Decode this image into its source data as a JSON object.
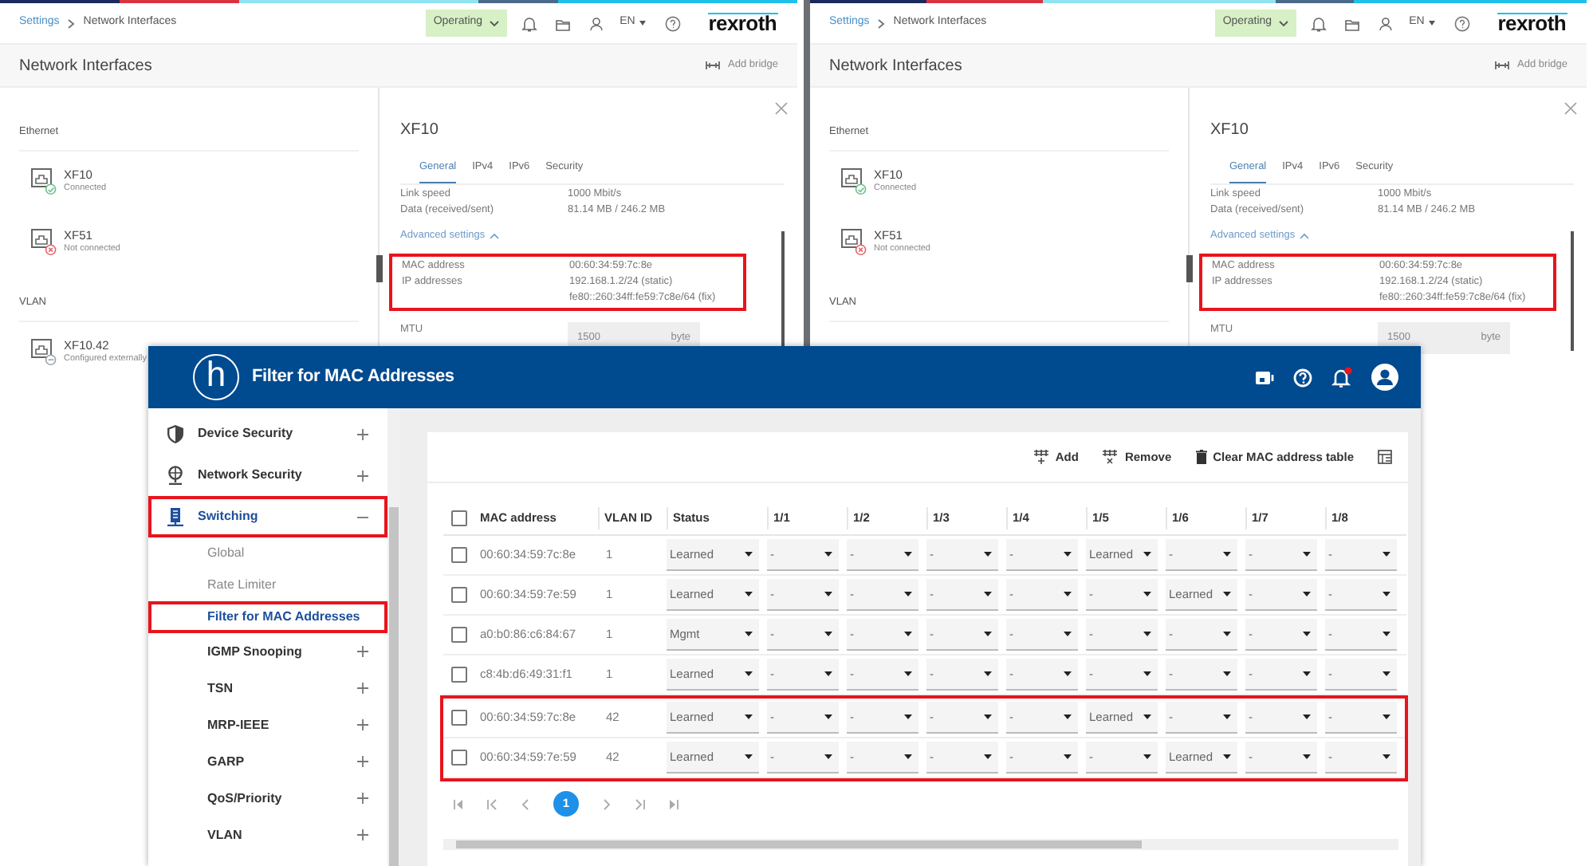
{
  "screens": [
    {
      "breadcrumb": [
        "Settings",
        "Network Interfaces"
      ],
      "mode": "Operating",
      "language": "EN",
      "brand": "rexroth",
      "page_title": "Network Interfaces",
      "add_bridge": "Add bridge",
      "groups": [
        {
          "heading": "Ethernet",
          "items": [
            {
              "name": "XF10",
              "status": "Connected",
              "kind": "connected"
            },
            {
              "name": "XF51",
              "status": "Not connected",
              "kind": "disconnected"
            }
          ]
        },
        {
          "heading": "VLAN",
          "items": [
            {
              "name": "XF10.42",
              "status": "Configured externally",
              "kind": "external"
            }
          ]
        }
      ],
      "detail": {
        "title": "XF10",
        "tabs": [
          {
            "label": "General",
            "selected": true
          },
          {
            "label": "IPv4",
            "selected": false
          },
          {
            "label": "IPv6",
            "selected": false
          },
          {
            "label": "Security",
            "selected": false
          }
        ],
        "fields": [
          {
            "label": "Link speed",
            "values": [
              "1000 Mbit/s"
            ]
          },
          {
            "label": "Data (received/sent)",
            "values": [
              "81.14 MB / 246.2 MB"
            ]
          }
        ],
        "advanced_link": "Advanced settings",
        "advanced_highlighted": true,
        "advanced_fields": [
          {
            "label": "MAC address",
            "values": [
              "00:60:34:59:7c:8e"
            ]
          },
          {
            "label": "IP addresses",
            "values": [
              "192.168.1.2/24 (static)",
              "fe80::260:34ff:fe59:7c8e/64 (fix)"
            ]
          }
        ],
        "mtu": {
          "label": "MTU",
          "value": "1500",
          "unit": "byte"
        }
      }
    },
    {
      "breadcrumb": [
        "Settings",
        "Network Interfaces"
      ],
      "mode": "Operating",
      "language": "EN",
      "brand": "rexroth",
      "page_title": "Network Interfaces",
      "add_bridge": "Add bridge",
      "groups": [
        {
          "heading": "Ethernet",
          "items": [
            {
              "name": "XF10",
              "status": "Connected",
              "kind": "connected"
            },
            {
              "name": "XF51",
              "status": "Not connected",
              "kind": "disconnected"
            }
          ]
        },
        {
          "heading": "VLAN"
        }
      ],
      "detail": {
        "title": "XF10",
        "tabs": [
          {
            "label": "General",
            "selected": true
          },
          {
            "label": "IPv4",
            "selected": false
          },
          {
            "label": "IPv6",
            "selected": false
          },
          {
            "label": "Security",
            "selected": false
          }
        ],
        "fields": [
          {
            "label": "Link speed",
            "values": [
              "1000 Mbit/s"
            ]
          },
          {
            "label": "Data (received/sent)",
            "values": [
              "81.14 MB / 246.2 MB"
            ]
          }
        ],
        "advanced_link": "Advanced settings",
        "advanced_highlighted": true,
        "advanced_fields": [
          {
            "label": "MAC address",
            "values": [
              "00:60:34:59:7c:8e"
            ]
          },
          {
            "label": "IP addresses",
            "values": [
              "192.168.1.2/24 (static)",
              "fe80::260:34ff:fe59:7c8e/64 (fix)"
            ]
          }
        ],
        "mtu": {
          "label": "MTU",
          "value": "1500",
          "unit": "byte"
        }
      }
    }
  ],
  "dialog": {
    "logo_letter": "h",
    "title": "Filter for MAC Addresses",
    "notification_badge": true,
    "sidebar": [
      {
        "label": "Device Security",
        "kind": "group",
        "expanded": false,
        "selected": false,
        "highlighted": false
      },
      {
        "label": "Network Security",
        "kind": "group",
        "expanded": false,
        "selected": false,
        "highlighted": false
      },
      {
        "label": "Switching",
        "kind": "group",
        "expanded": true,
        "selected": true,
        "highlighted": true
      },
      {
        "label": "Global",
        "kind": "page",
        "selected": false,
        "highlighted": false
      },
      {
        "label": "Rate Limiter",
        "kind": "page",
        "selected": false,
        "highlighted": false
      },
      {
        "label": "Filter for MAC Addresses",
        "kind": "page",
        "selected": true,
        "highlighted": true
      },
      {
        "label": "IGMP Snooping",
        "kind": "subgroup",
        "expanded": false,
        "selected": false,
        "highlighted": false
      },
      {
        "label": "TSN",
        "kind": "subgroup",
        "expanded": false,
        "selected": false,
        "highlighted": false
      },
      {
        "label": "MRP-IEEE",
        "kind": "subgroup",
        "expanded": false,
        "selected": false,
        "highlighted": false
      },
      {
        "label": "GARP",
        "kind": "subgroup",
        "expanded": false,
        "selected": false,
        "highlighted": false
      },
      {
        "label": "QoS/Priority",
        "kind": "subgroup",
        "expanded": false,
        "selected": false,
        "highlighted": false
      },
      {
        "label": "VLAN",
        "kind": "subgroup",
        "expanded": false,
        "selected": false,
        "highlighted": false
      }
    ],
    "toolbar": [
      "Add",
      "Remove",
      "Clear MAC address table"
    ],
    "select_all_checked": false,
    "columns": [
      "MAC address",
      "VLAN ID",
      "Status",
      "1/1",
      "1/2",
      "1/3",
      "1/4",
      "1/5",
      "1/6",
      "1/7",
      "1/8"
    ],
    "rows": [
      {
        "mac": "00:60:34:59:7c:8e",
        "vlan": "1",
        "status": "Learned",
        "ports": [
          "-",
          "-",
          "-",
          "-",
          "Learned",
          "-",
          "-",
          "-"
        ],
        "checked": false,
        "highlighted": false
      },
      {
        "mac": "00:60:34:59:7e:59",
        "vlan": "1",
        "status": "Learned",
        "ports": [
          "-",
          "-",
          "-",
          "-",
          "-",
          "Learned",
          "-",
          "-"
        ],
        "checked": false,
        "highlighted": false
      },
      {
        "mac": "a0:b0:86:c6:84:67",
        "vlan": "1",
        "status": "Mgmt",
        "ports": [
          "-",
          "-",
          "-",
          "-",
          "-",
          "-",
          "-",
          "-"
        ],
        "checked": false,
        "highlighted": false
      },
      {
        "mac": "c8:4b:d6:49:31:f1",
        "vlan": "1",
        "status": "Learned",
        "ports": [
          "-",
          "-",
          "-",
          "-",
          "-",
          "-",
          "-",
          "-"
        ],
        "checked": false,
        "highlighted": false
      },
      {
        "mac": "00:60:34:59:7c:8e",
        "vlan": "42",
        "status": "Learned",
        "ports": [
          "-",
          "-",
          "-",
          "-",
          "Learned",
          "-",
          "-",
          "-"
        ],
        "checked": false,
        "highlighted": true
      },
      {
        "mac": "00:60:34:59:7e:59",
        "vlan": "42",
        "status": "Learned",
        "ports": [
          "-",
          "-",
          "-",
          "-",
          "-",
          "Learned",
          "-",
          "-"
        ],
        "checked": false,
        "highlighted": true
      }
    ],
    "pages": [
      {
        "label": "1",
        "selected": true
      }
    ]
  }
}
